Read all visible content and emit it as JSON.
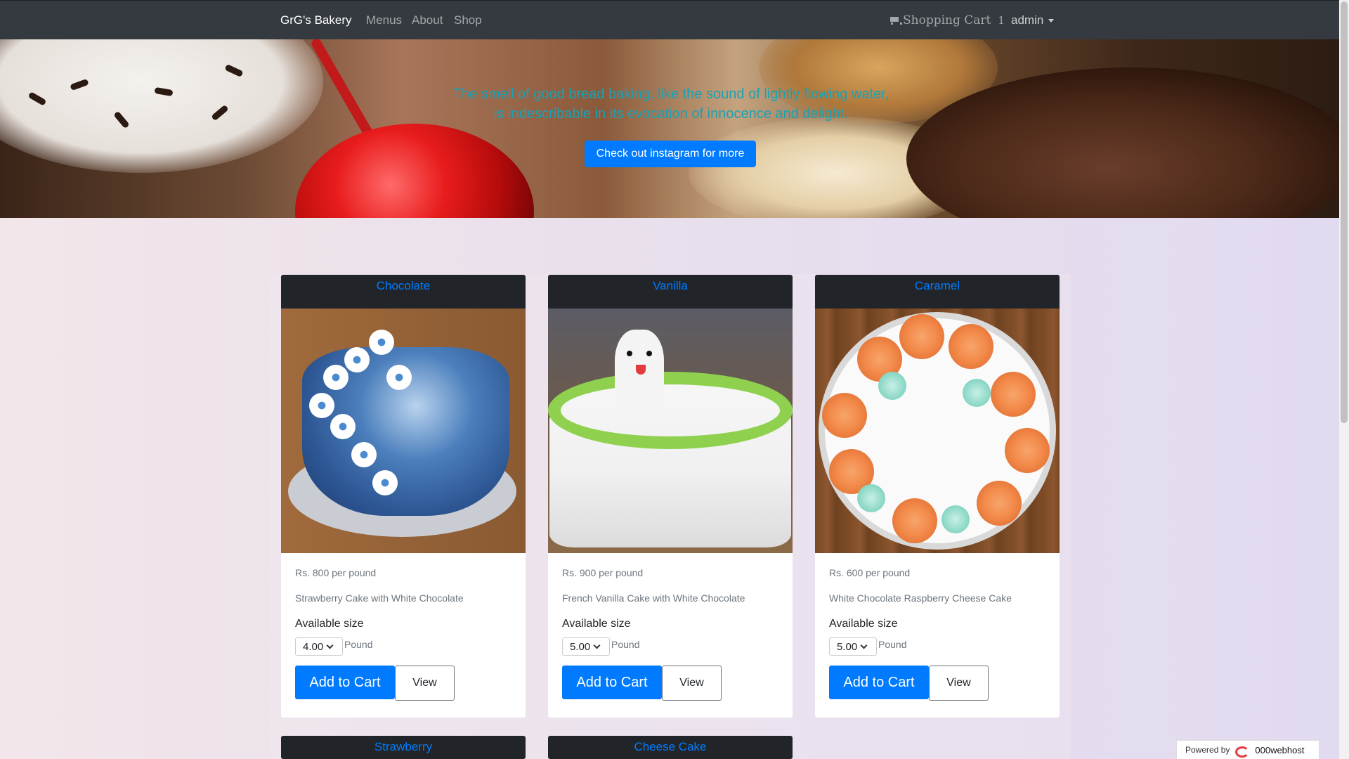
{
  "nav": {
    "brand": "GrG's Bakery",
    "links": [
      "Menus",
      "About",
      "Shop"
    ],
    "cart_label": "Shopping Cart",
    "cart_count": "1",
    "user": "admin"
  },
  "hero": {
    "quote": "The smell of good bread baking, like the sound of lightly flowing water, is indescribable in its evocation of innocence and delight.",
    "button": "Check out instagram for more"
  },
  "products": [
    {
      "title": "Chocolate",
      "price": "Rs. 800 per pound",
      "description": "Strawberry Cake with White Chocolate",
      "available_label": "Available size",
      "size": "4.00",
      "unit": "Pound",
      "add_label": "Add to Cart",
      "view_label": "View"
    },
    {
      "title": "Vanilla",
      "price": "Rs. 900 per pound",
      "description": "French Vanilla Cake with White Chocolate",
      "available_label": "Available size",
      "size": "5.00",
      "unit": "Pound",
      "add_label": "Add to Cart",
      "view_label": "View"
    },
    {
      "title": "Caramel",
      "price": "Rs. 600 per pound",
      "description": "White Chocolate Raspberry Cheese Cake",
      "available_label": "Available size",
      "size": "5.00",
      "unit": "Pound",
      "add_label": "Add to Cart",
      "view_label": "View"
    },
    {
      "title": "Strawberry"
    },
    {
      "title": "Cheese Cake"
    }
  ],
  "footer": {
    "powered_label": "Powered by",
    "powered_brand": "000webhost"
  },
  "colors": {
    "navbar": "#343a40",
    "primary": "#007bff",
    "quote": "#17a2b8",
    "card_header": "#212529"
  }
}
